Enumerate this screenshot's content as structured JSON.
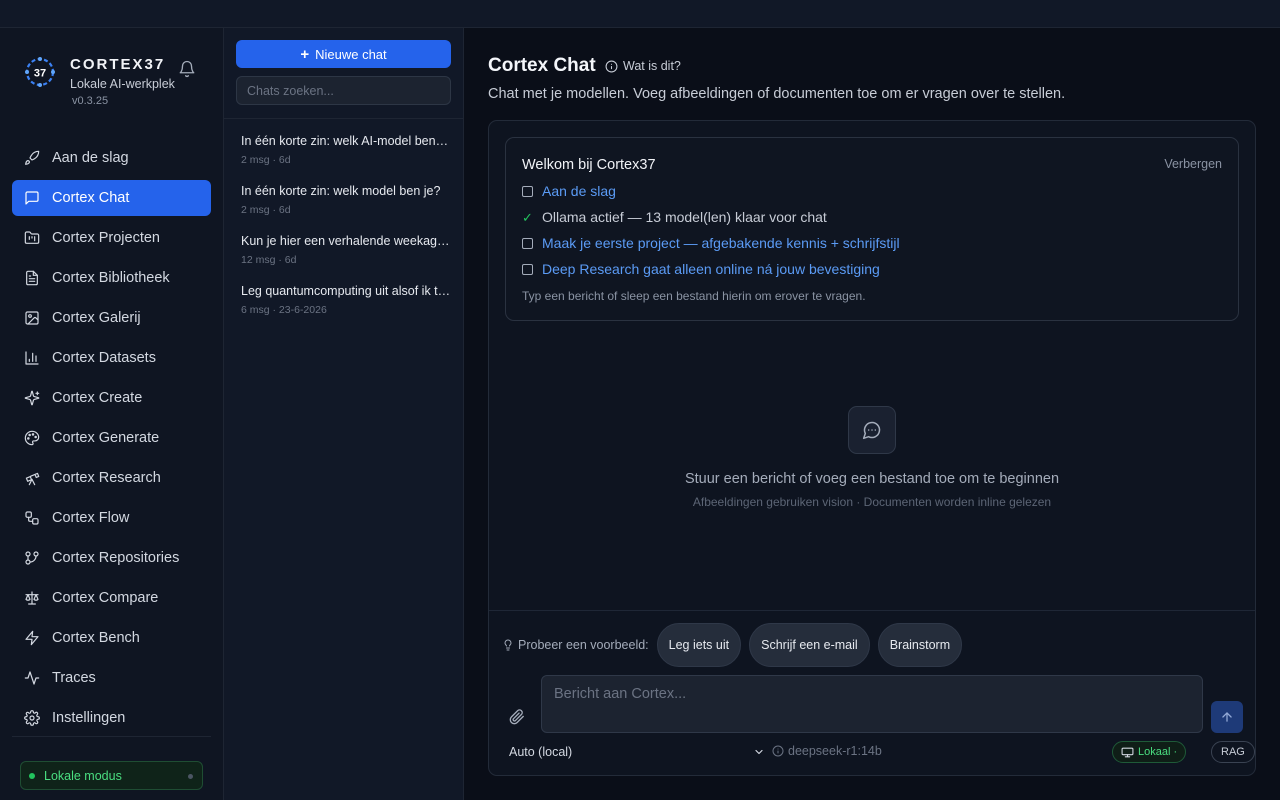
{
  "brand": {
    "name": "CORTEX37",
    "subtitle": "Lokale AI-werkplek",
    "version": "v0.3.25",
    "logo_text": "37"
  },
  "sidebar": {
    "items": [
      {
        "label": "Aan de slag",
        "icon": "rocket-icon",
        "active": false
      },
      {
        "label": "Cortex Chat",
        "icon": "chat-icon",
        "active": true
      },
      {
        "label": "Cortex Projecten",
        "icon": "folder-icon",
        "active": false
      },
      {
        "label": "Cortex Bibliotheek",
        "icon": "document-icon",
        "active": false
      },
      {
        "label": "Cortex Galerij",
        "icon": "image-icon",
        "active": false
      },
      {
        "label": "Cortex Datasets",
        "icon": "bar-chart-icon",
        "active": false
      },
      {
        "label": "Cortex Create",
        "icon": "sparkles-icon",
        "active": false
      },
      {
        "label": "Cortex Generate",
        "icon": "palette-icon",
        "active": false
      },
      {
        "label": "Cortex Research",
        "icon": "telescope-icon",
        "active": false
      },
      {
        "label": "Cortex Flow",
        "icon": "flow-icon",
        "active": false
      },
      {
        "label": "Cortex Repositories",
        "icon": "git-branch-icon",
        "active": false
      },
      {
        "label": "Cortex Compare",
        "icon": "scale-icon",
        "active": false
      },
      {
        "label": "Cortex Bench",
        "icon": "lightning-icon",
        "active": false
      },
      {
        "label": "Traces",
        "icon": "activity-icon",
        "active": false
      },
      {
        "label": "Instellingen",
        "icon": "gear-icon",
        "active": false
      }
    ],
    "local_mode_label": "Lokale modus"
  },
  "chatlist": {
    "new_chat_label": "Nieuwe chat",
    "search_placeholder": "Chats zoeken...",
    "conversations": [
      {
        "title": "In één korte zin: welk AI-model ben je?",
        "meta": "2 msg · 6d"
      },
      {
        "title": "In één korte zin: welk model ben je?",
        "meta": "2 msg · 6d"
      },
      {
        "title": "Kun je hier een verhalende weekagenda van maken?",
        "meta": "12 msg · 6d"
      },
      {
        "title": "Leg quantumcomputing uit alsof ik tien ben",
        "meta": "6 msg · 23-6-2026"
      }
    ]
  },
  "main": {
    "title": "Cortex Chat",
    "whatis_label": "Wat is dit?",
    "subtitle": "Chat met je modellen. Voeg afbeeldingen of documenten toe om er vragen over te stellen."
  },
  "welcome": {
    "title": "Welkom bij Cortex37",
    "hide_label": "Verbergen",
    "items": [
      {
        "text": "Aan de slag",
        "done": false
      },
      {
        "text": "Ollama actief — 13 model(len) klaar voor chat",
        "done": true
      },
      {
        "text": "Maak je eerste project — afgebakende kennis + schrijfstijl",
        "done": false
      },
      {
        "text": "Deep Research gaat alleen online ná jouw bevestiging",
        "done": false
      }
    ],
    "hint": "Typ een bericht of sleep een bestand hierin om erover te vragen."
  },
  "empty_state": {
    "title": "Stuur een bericht of voeg een bestand toe om te beginnen",
    "subtitle": "Afbeeldingen gebruiken vision · Documenten worden inline gelezen"
  },
  "composer": {
    "examples_label": "Probeer een voorbeeld:",
    "examples": [
      "Leg iets uit",
      "Schrijf een e-mail",
      "Brainstorm"
    ],
    "placeholder": "Bericht aan Cortex...",
    "model_select": "Auto (local)",
    "model_name": "deepseek-r1:14b",
    "local_badge": "Lokaal ·",
    "rag_badge": "RAG"
  },
  "colors": {
    "accent": "#2563eb",
    "link": "#5b9bf5",
    "success": "#22c55e",
    "background": "#0a0e18"
  }
}
